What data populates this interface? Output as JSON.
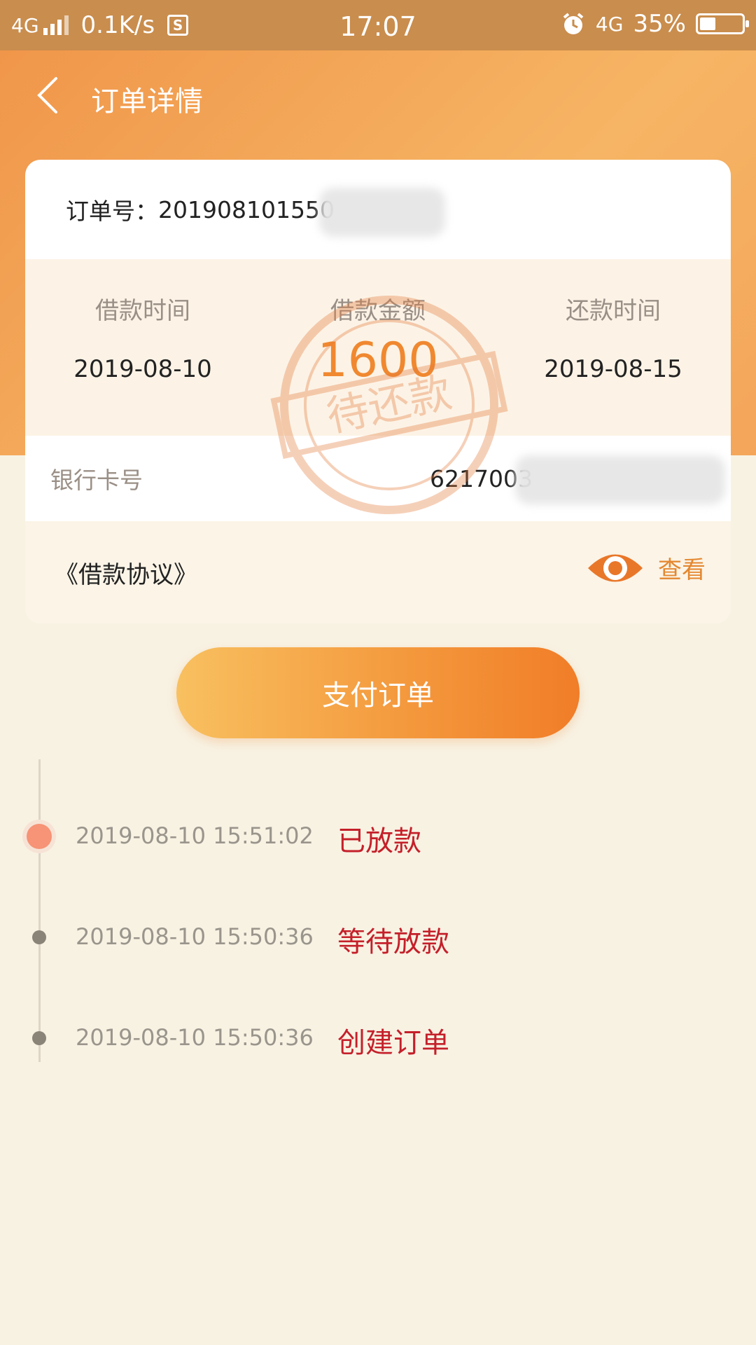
{
  "status_bar": {
    "network": "4G",
    "speed": "0.1K/s",
    "s_icon_label": "S",
    "time": "17:07",
    "network_right": "4G",
    "battery": "35%",
    "battery_level": 0.35
  },
  "nav": {
    "back_icon": "chevron-left-icon",
    "title": "订单详情"
  },
  "order": {
    "label": "订单号：",
    "number": "201908101550"
  },
  "info": {
    "borrow_time_label": "借款时间",
    "borrow_time": "2019-08-10",
    "amount_label": "借款金额",
    "amount": "1600",
    "repay_time_label": "还款时间",
    "repay_time": "2019-08-15",
    "stamp_text": "待还款"
  },
  "bank": {
    "label": "银行卡号",
    "number": "6217003"
  },
  "agreement": {
    "label": "《借款协议》",
    "view_label": "查看",
    "view_icon": "eye-icon"
  },
  "pay_button": {
    "label": "支付订单"
  },
  "timeline": [
    {
      "time": "2019-08-10 15:51:02",
      "status": "已放款",
      "active": true
    },
    {
      "time": "2019-08-10 15:50:36",
      "status": "等待放款",
      "active": false
    },
    {
      "time": "2019-08-10 15:50:36",
      "status": "创建订单",
      "active": false
    }
  ],
  "colors": {
    "header_start": "#f0964a",
    "header_end": "#f6b564",
    "accent": "#f08830",
    "status_red": "#c4202a",
    "background": "#f8f2e3"
  }
}
